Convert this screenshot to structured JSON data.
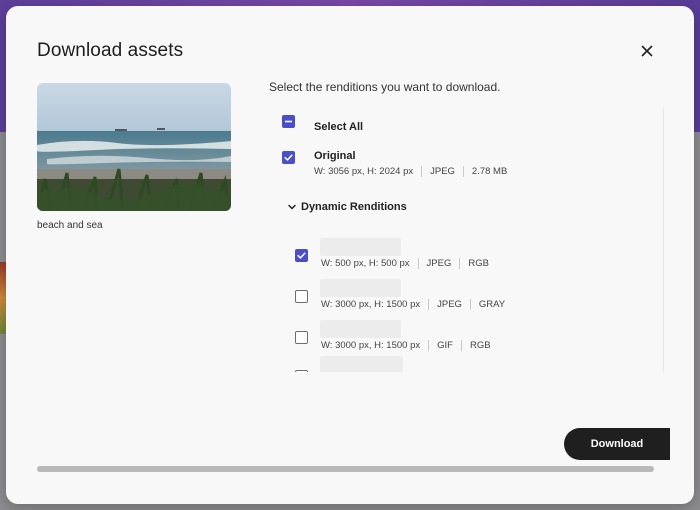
{
  "modal": {
    "title": "Download assets",
    "close_icon": "close-icon",
    "instruction": "Select the renditions you want to download.",
    "preview_caption": "beach and sea",
    "select_all": {
      "label": "Select All",
      "state": "indeterminate"
    },
    "original": {
      "label": "Original",
      "checked": true,
      "dimensions": "W: 3056 px, H: 2024 px",
      "format": "JPEG",
      "size": "2.78 MB"
    },
    "dynamic_section": {
      "label": "Dynamic Renditions",
      "expanded": true,
      "items": [
        {
          "checked": true,
          "dimensions": "W: 500 px, H: 500 px",
          "format": "JPEG",
          "color": "RGB"
        },
        {
          "checked": false,
          "dimensions": "W: 3000 px, H: 1500 px",
          "format": "JPEG",
          "color": "GRAY"
        },
        {
          "checked": false,
          "dimensions": "W: 3000 px, H: 1500 px",
          "format": "GIF",
          "color": "RGB"
        }
      ]
    },
    "download_label": "Download"
  },
  "colors": {
    "accent": "#4a4fc7",
    "button_dark": "#1f1f1f",
    "background_header": "#6a45a3"
  }
}
